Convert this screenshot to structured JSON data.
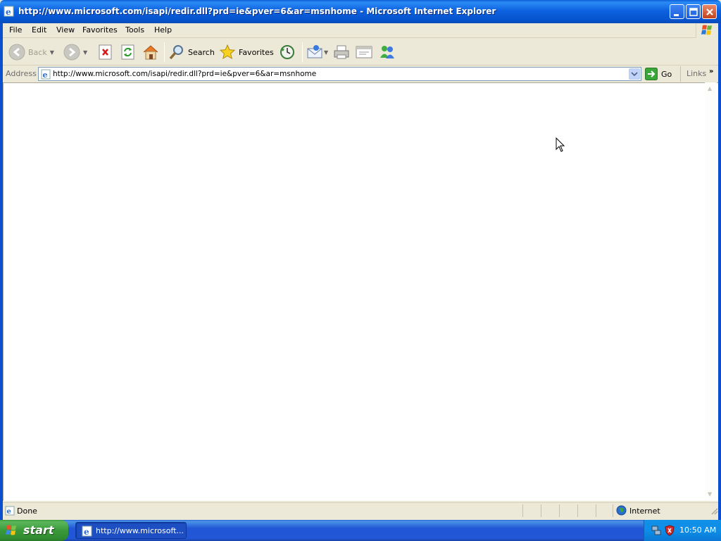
{
  "window": {
    "title": "http://www.microsoft.com/isapi/redir.dll?prd=ie&pver=6&ar=msnhome - Microsoft Internet Explorer"
  },
  "menu": {
    "items": [
      "File",
      "Edit",
      "View",
      "Favorites",
      "Tools",
      "Help"
    ]
  },
  "toolbar": {
    "back_label": "Back",
    "search_label": "Search",
    "favorites_label": "Favorites"
  },
  "address": {
    "label": "Address",
    "url": "http://www.microsoft.com/isapi/redir.dll?prd=ie&pver=6&ar=msnhome",
    "go_label": "Go",
    "links_label": "Links",
    "more_glyph": "»"
  },
  "status": {
    "text": "Done",
    "zone": "Internet"
  },
  "taskbar": {
    "start_label": "start",
    "task_label": "http://www.microsoft...",
    "clock": "10:50 AM"
  },
  "icons": {
    "back": "back-arrow-icon",
    "forward": "forward-arrow-icon",
    "stop": "stop-icon",
    "refresh": "refresh-icon",
    "home": "home-icon",
    "search": "search-icon",
    "favorites": "star-icon",
    "history": "history-icon",
    "mail": "mail-icon",
    "print": "printer-icon",
    "edit": "edit-icon",
    "messenger": "messenger-icon"
  },
  "colors": {
    "titlebar": "#0a5fd8",
    "taskbar": "#2157d7",
    "start": "#3a9a3a",
    "tray": "#0d8ee8"
  }
}
